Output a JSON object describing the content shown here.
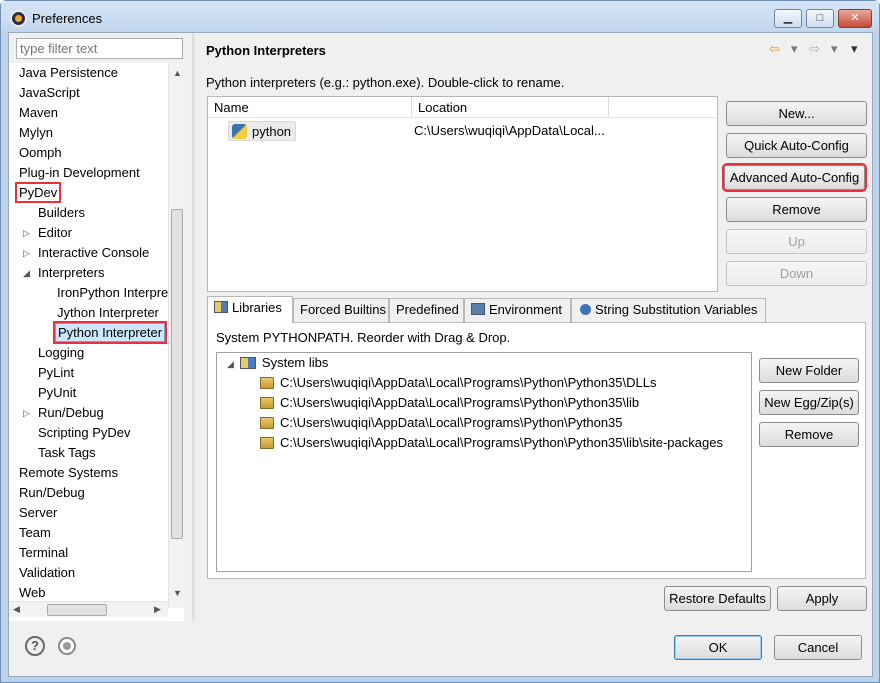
{
  "window": {
    "title": "Preferences",
    "controls": {
      "minimize": "▁",
      "maximize": "□",
      "close": "✕"
    }
  },
  "sidebar": {
    "filter_placeholder": "type filter text",
    "items": [
      {
        "label": "Java Persistence",
        "level": 0
      },
      {
        "label": "JavaScript",
        "level": 0
      },
      {
        "label": "Maven",
        "level": 0
      },
      {
        "label": "Mylyn",
        "level": 0
      },
      {
        "label": "Oomph",
        "level": 0
      },
      {
        "label": "Plug-in Development",
        "level": 0
      },
      {
        "label": "PyDev",
        "level": 0,
        "highlighted": true
      },
      {
        "label": "Builders",
        "level": 1
      },
      {
        "label": "Editor",
        "level": 1,
        "expander": "collapsed"
      },
      {
        "label": "Interactive Console",
        "level": 1,
        "expander": "collapsed"
      },
      {
        "label": "Interpreters",
        "level": 1,
        "expander": "expanded"
      },
      {
        "label": "IronPython Interpreter",
        "level": 2
      },
      {
        "label": "Jython Interpreter",
        "level": 2
      },
      {
        "label": "Python Interpreter",
        "level": 2,
        "selected": true,
        "highlighted": true
      },
      {
        "label": "Logging",
        "level": 1
      },
      {
        "label": "PyLint",
        "level": 1
      },
      {
        "label": "PyUnit",
        "level": 1
      },
      {
        "label": "Run/Debug",
        "level": 1,
        "expander": "collapsed"
      },
      {
        "label": "Scripting PyDev",
        "level": 1
      },
      {
        "label": "Task Tags",
        "level": 1
      },
      {
        "label": "Remote Systems",
        "level": 0
      },
      {
        "label": "Run/Debug",
        "level": 0
      },
      {
        "label": "Server",
        "level": 0
      },
      {
        "label": "Team",
        "level": 0
      },
      {
        "label": "Terminal",
        "level": 0
      },
      {
        "label": "Validation",
        "level": 0
      },
      {
        "label": "Web",
        "level": 0
      }
    ]
  },
  "page": {
    "title": "Python Interpreters",
    "description": "Python interpreters (e.g.: python.exe).   Double-click to rename.",
    "nav": {
      "back": "⇦",
      "back_menu": "▾",
      "forward": "⇨",
      "forward_menu": "▾",
      "view_menu": "▾"
    },
    "table": {
      "columns": [
        "Name",
        "Location"
      ],
      "rows": [
        {
          "name": "python",
          "location": "C:\\Users\\wuqiqi\\AppData\\Local..."
        }
      ]
    },
    "buttons": {
      "new": "New...",
      "quick_auto_config": "Quick Auto-Config",
      "advanced_auto_config": "Advanced Auto-Config",
      "remove": "Remove",
      "up": "Up",
      "down": "Down"
    },
    "tabs": [
      {
        "label": "Libraries",
        "active": true
      },
      {
        "label": "Forced Builtins"
      },
      {
        "label": "Predefined"
      },
      {
        "label": "Environment"
      },
      {
        "label": "String Substitution Variables"
      }
    ],
    "libraries": {
      "description": "System PYTHONPATH.   Reorder with Drag & Drop.",
      "root": "System libs",
      "paths": [
        "C:\\Users\\wuqiqi\\AppData\\Local\\Programs\\Python\\Python35\\DLLs",
        "C:\\Users\\wuqiqi\\AppData\\Local\\Programs\\Python\\Python35\\lib",
        "C:\\Users\\wuqiqi\\AppData\\Local\\Programs\\Python\\Python35",
        "C:\\Users\\wuqiqi\\AppData\\Local\\Programs\\Python\\Python35\\lib\\site-packages"
      ],
      "buttons": {
        "new_folder": "New Folder",
        "new_egg_zip": "New Egg/Zip(s)",
        "remove": "Remove"
      }
    },
    "restore_defaults": "Restore Defaults",
    "apply": "Apply"
  },
  "footer": {
    "help": "?",
    "ok": "OK",
    "cancel": "Cancel"
  },
  "colors": {
    "highlight_box": "#e8313a",
    "selection": "#cce8ff"
  }
}
